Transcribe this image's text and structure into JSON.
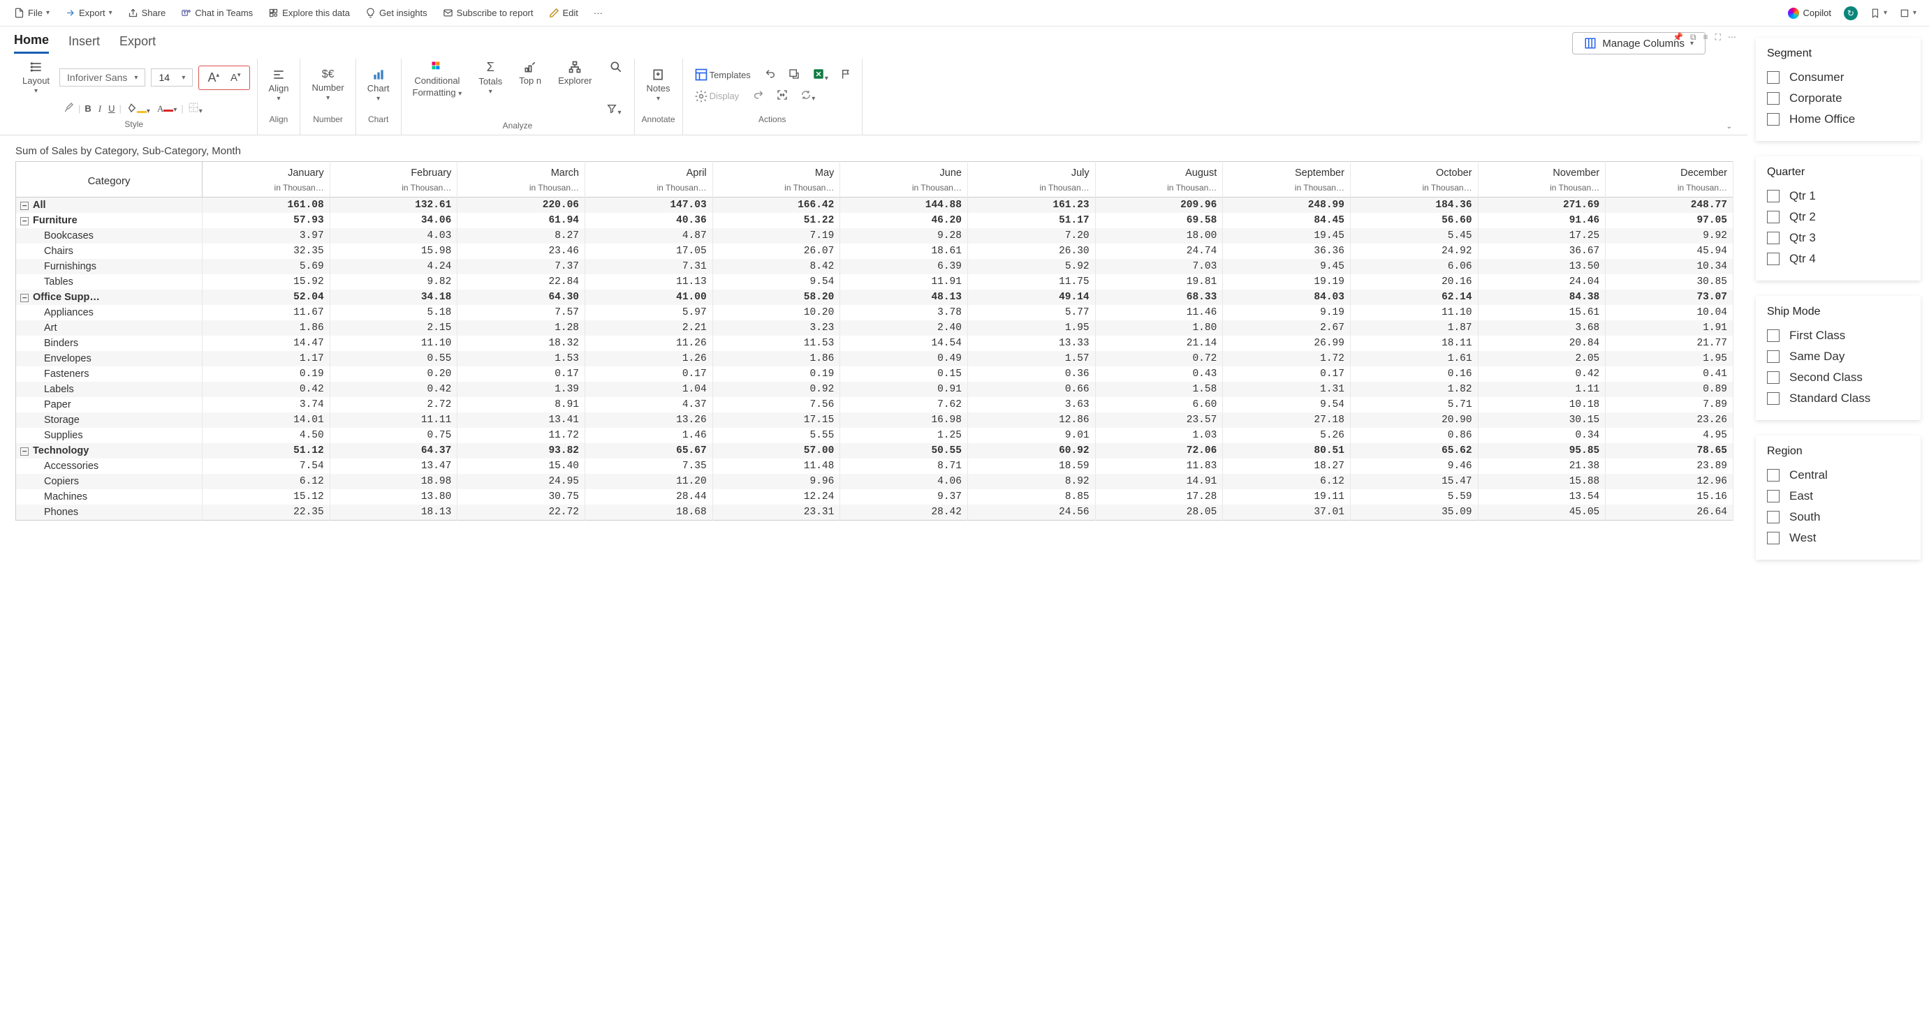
{
  "topbar": {
    "file": "File",
    "export": "Export",
    "share": "Share",
    "chat": "Chat in Teams",
    "explore": "Explore this data",
    "insights": "Get insights",
    "subscribe": "Subscribe to report",
    "edit": "Edit",
    "copilot": "Copilot"
  },
  "tabs": {
    "home": "Home",
    "insert": "Insert",
    "export": "Export"
  },
  "manage_cols": "Manage Columns",
  "ribbon": {
    "layout": "Layout",
    "font_name": "Inforiver Sans",
    "font_size": "14",
    "align": "Align",
    "number": "Number",
    "chart": "Chart",
    "conditional": "Conditional",
    "formatting": "Formatting",
    "totals": "Totals",
    "topn": "Top n",
    "explorer": "Explorer",
    "notes": "Notes",
    "templates": "Templates",
    "display": "Display",
    "g_style": "Style",
    "g_align": "Align",
    "g_number": "Number",
    "g_chart": "Chart",
    "g_analyze": "Analyze",
    "g_annotate": "Annotate",
    "g_actions": "Actions"
  },
  "title": "Sum of Sales by Category, Sub-Category, Month",
  "table": {
    "category_header": "Category",
    "months": [
      "January",
      "February",
      "March",
      "April",
      "May",
      "June",
      "July",
      "August",
      "September",
      "October",
      "November",
      "December"
    ],
    "unit": "in Thousan…",
    "rows": [
      {
        "type": "group",
        "label": "All",
        "vals": [
          "161.08",
          "132.61",
          "220.06",
          "147.03",
          "166.42",
          "144.88",
          "161.23",
          "209.96",
          "248.99",
          "184.36",
          "271.69",
          "248.77"
        ]
      },
      {
        "type": "group",
        "label": "Furniture",
        "vals": [
          "57.93",
          "34.06",
          "61.94",
          "40.36",
          "51.22",
          "46.20",
          "51.17",
          "69.58",
          "84.45",
          "56.60",
          "91.46",
          "97.05"
        ]
      },
      {
        "type": "sub",
        "label": "Bookcases",
        "vals": [
          "3.97",
          "4.03",
          "8.27",
          "4.87",
          "7.19",
          "9.28",
          "7.20",
          "18.00",
          "19.45",
          "5.45",
          "17.25",
          "9.92"
        ]
      },
      {
        "type": "sub",
        "label": "Chairs",
        "vals": [
          "32.35",
          "15.98",
          "23.46",
          "17.05",
          "26.07",
          "18.61",
          "26.30",
          "24.74",
          "36.36",
          "24.92",
          "36.67",
          "45.94"
        ]
      },
      {
        "type": "sub",
        "label": "Furnishings",
        "vals": [
          "5.69",
          "4.24",
          "7.37",
          "7.31",
          "8.42",
          "6.39",
          "5.92",
          "7.03",
          "9.45",
          "6.06",
          "13.50",
          "10.34"
        ]
      },
      {
        "type": "sub",
        "label": "Tables",
        "vals": [
          "15.92",
          "9.82",
          "22.84",
          "11.13",
          "9.54",
          "11.91",
          "11.75",
          "19.81",
          "19.19",
          "20.16",
          "24.04",
          "30.85"
        ]
      },
      {
        "type": "group",
        "label": "Office Supp…",
        "vals": [
          "52.04",
          "34.18",
          "64.30",
          "41.00",
          "58.20",
          "48.13",
          "49.14",
          "68.33",
          "84.03",
          "62.14",
          "84.38",
          "73.07"
        ]
      },
      {
        "type": "sub",
        "label": "Appliances",
        "vals": [
          "11.67",
          "5.18",
          "7.57",
          "5.97",
          "10.20",
          "3.78",
          "5.77",
          "11.46",
          "9.19",
          "11.10",
          "15.61",
          "10.04"
        ]
      },
      {
        "type": "sub",
        "label": "Art",
        "vals": [
          "1.86",
          "2.15",
          "1.28",
          "2.21",
          "3.23",
          "2.40",
          "1.95",
          "1.80",
          "2.67",
          "1.87",
          "3.68",
          "1.91"
        ]
      },
      {
        "type": "sub",
        "label": "Binders",
        "vals": [
          "14.47",
          "11.10",
          "18.32",
          "11.26",
          "11.53",
          "14.54",
          "13.33",
          "21.14",
          "26.99",
          "18.11",
          "20.84",
          "21.77"
        ]
      },
      {
        "type": "sub",
        "label": "Envelopes",
        "vals": [
          "1.17",
          "0.55",
          "1.53",
          "1.26",
          "1.86",
          "0.49",
          "1.57",
          "0.72",
          "1.72",
          "1.61",
          "2.05",
          "1.95"
        ]
      },
      {
        "type": "sub",
        "label": "Fasteners",
        "vals": [
          "0.19",
          "0.20",
          "0.17",
          "0.17",
          "0.19",
          "0.15",
          "0.36",
          "0.43",
          "0.17",
          "0.16",
          "0.42",
          "0.41"
        ]
      },
      {
        "type": "sub",
        "label": "Labels",
        "vals": [
          "0.42",
          "0.42",
          "1.39",
          "1.04",
          "0.92",
          "0.91",
          "0.66",
          "1.58",
          "1.31",
          "1.82",
          "1.11",
          "0.89"
        ]
      },
      {
        "type": "sub",
        "label": "Paper",
        "vals": [
          "3.74",
          "2.72",
          "8.91",
          "4.37",
          "7.56",
          "7.62",
          "3.63",
          "6.60",
          "9.54",
          "5.71",
          "10.18",
          "7.89"
        ]
      },
      {
        "type": "sub",
        "label": "Storage",
        "vals": [
          "14.01",
          "11.11",
          "13.41",
          "13.26",
          "17.15",
          "16.98",
          "12.86",
          "23.57",
          "27.18",
          "20.90",
          "30.15",
          "23.26"
        ]
      },
      {
        "type": "sub",
        "label": "Supplies",
        "vals": [
          "4.50",
          "0.75",
          "11.72",
          "1.46",
          "5.55",
          "1.25",
          "9.01",
          "1.03",
          "5.26",
          "0.86",
          "0.34",
          "4.95"
        ]
      },
      {
        "type": "group",
        "label": "Technology",
        "vals": [
          "51.12",
          "64.37",
          "93.82",
          "65.67",
          "57.00",
          "50.55",
          "60.92",
          "72.06",
          "80.51",
          "65.62",
          "95.85",
          "78.65"
        ]
      },
      {
        "type": "sub",
        "label": "Accessories",
        "vals": [
          "7.54",
          "13.47",
          "15.40",
          "7.35",
          "11.48",
          "8.71",
          "18.59",
          "11.83",
          "18.27",
          "9.46",
          "21.38",
          "23.89"
        ]
      },
      {
        "type": "sub",
        "label": "Copiers",
        "vals": [
          "6.12",
          "18.98",
          "24.95",
          "11.20",
          "9.96",
          "4.06",
          "8.92",
          "14.91",
          "6.12",
          "15.47",
          "15.88",
          "12.96"
        ]
      },
      {
        "type": "sub",
        "label": "Machines",
        "vals": [
          "15.12",
          "13.80",
          "30.75",
          "28.44",
          "12.24",
          "9.37",
          "8.85",
          "17.28",
          "19.11",
          "5.59",
          "13.54",
          "15.16"
        ]
      },
      {
        "type": "sub",
        "label": "Phones",
        "vals": [
          "22.35",
          "18.13",
          "22.72",
          "18.68",
          "23.31",
          "28.42",
          "24.56",
          "28.05",
          "37.01",
          "35.09",
          "45.05",
          "26.64"
        ]
      }
    ]
  },
  "filters": {
    "segment": {
      "title": "Segment",
      "opts": [
        "Consumer",
        "Corporate",
        "Home Office"
      ]
    },
    "quarter": {
      "title": "Quarter",
      "opts": [
        "Qtr 1",
        "Qtr 2",
        "Qtr 3",
        "Qtr 4"
      ]
    },
    "shipmode": {
      "title": "Ship Mode",
      "opts": [
        "First Class",
        "Same Day",
        "Second Class",
        "Standard Class"
      ]
    },
    "region": {
      "title": "Region",
      "opts": [
        "Central",
        "East",
        "South",
        "West"
      ]
    }
  }
}
